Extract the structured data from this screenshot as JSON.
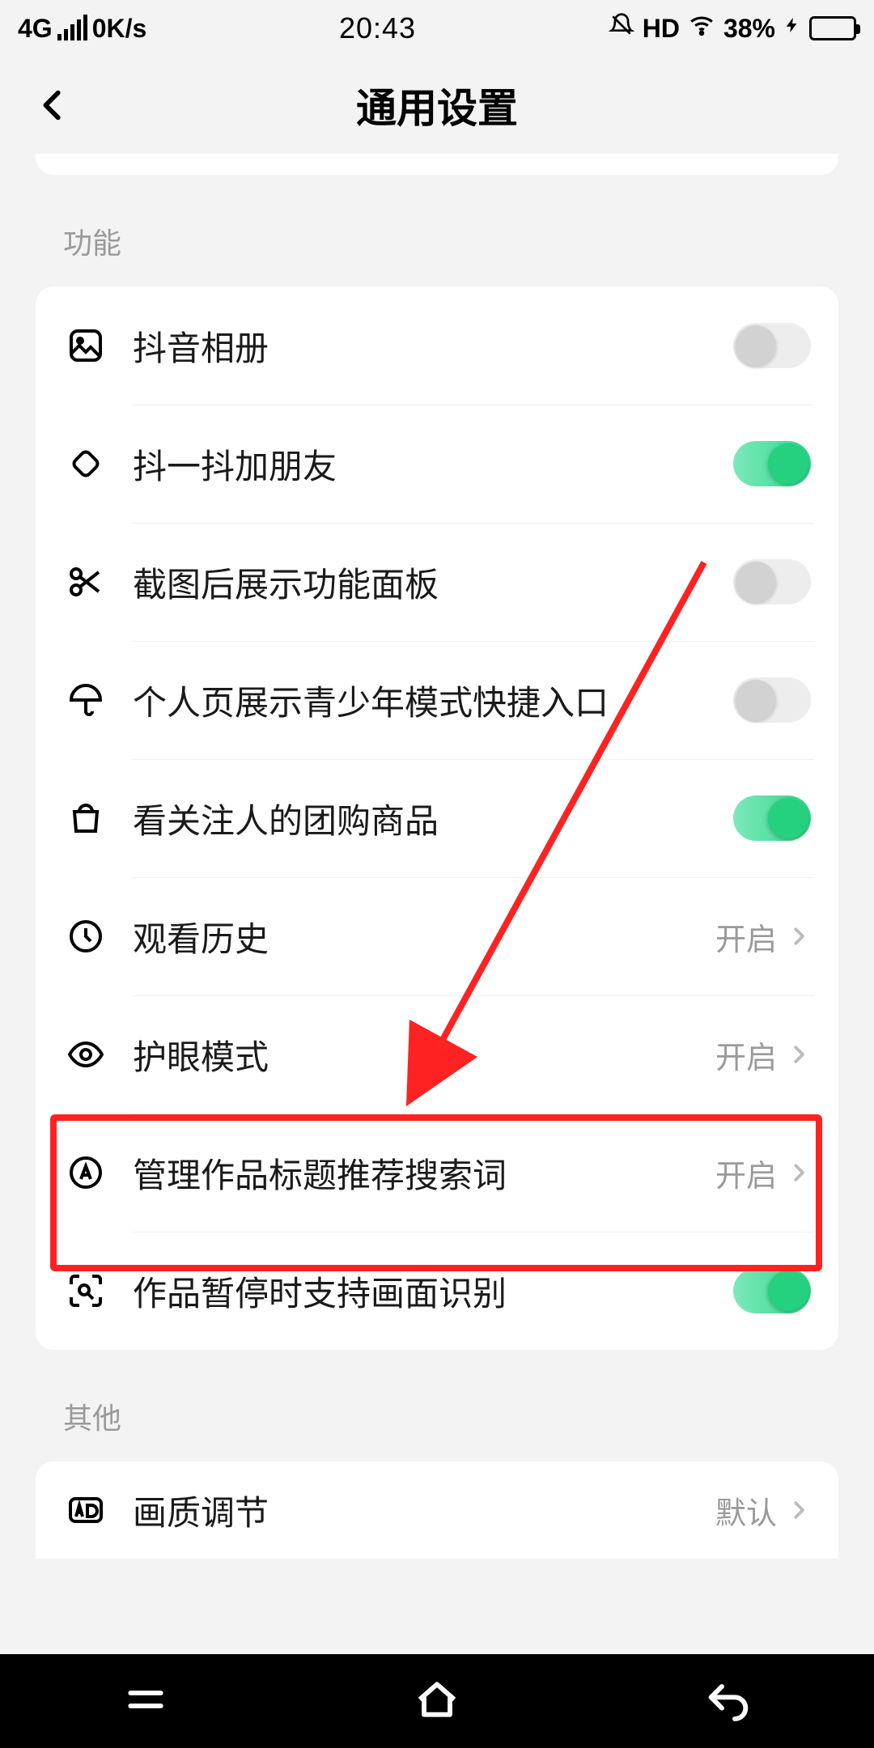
{
  "status": {
    "network": "4G",
    "speed": "0K/s",
    "time": "20:43",
    "hd": "HD",
    "battery_pct": "38%"
  },
  "header": {
    "title": "通用设置"
  },
  "sections": {
    "features": {
      "label": "功能",
      "items": [
        {
          "label": "抖音相册",
          "toggle": false
        },
        {
          "label": "抖一抖加朋友",
          "toggle": true
        },
        {
          "label": "截图后展示功能面板",
          "toggle": false
        },
        {
          "label": "个人页展示青少年模式快捷入口",
          "toggle": false
        },
        {
          "label": "看关注人的团购商品",
          "toggle": true
        },
        {
          "label": "观看历史",
          "value": "开启"
        },
        {
          "label": "护眼模式",
          "value": "开启"
        },
        {
          "label": "管理作品标题推荐搜索词",
          "value": "开启"
        },
        {
          "label": "作品暂停时支持画面识别",
          "toggle": true
        }
      ]
    },
    "others": {
      "label": "其他",
      "items": [
        {
          "label": "画质调节",
          "value": "默认"
        }
      ]
    }
  }
}
